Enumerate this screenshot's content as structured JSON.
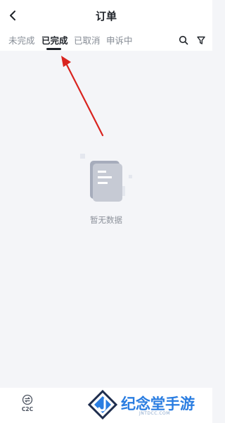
{
  "header": {
    "title": "订单"
  },
  "tabs": [
    {
      "label": "未完成",
      "active": false
    },
    {
      "label": "已完成",
      "active": true
    },
    {
      "label": "已取消",
      "active": false
    },
    {
      "label": "申诉中",
      "active": false
    }
  ],
  "tools": {
    "search_icon": "search-icon",
    "filter_icon": "filter-icon"
  },
  "empty_state": {
    "text": "暂无数据"
  },
  "bottom_nav": {
    "c2c_label": "C2C"
  },
  "watermark": {
    "title": "纪念堂手游",
    "url": "JNTDCC.COM"
  },
  "colors": {
    "accent_text": "#1f2329",
    "muted_text": "#868c95",
    "arrow": "#d9241f",
    "watermark": "#2a7de1"
  }
}
